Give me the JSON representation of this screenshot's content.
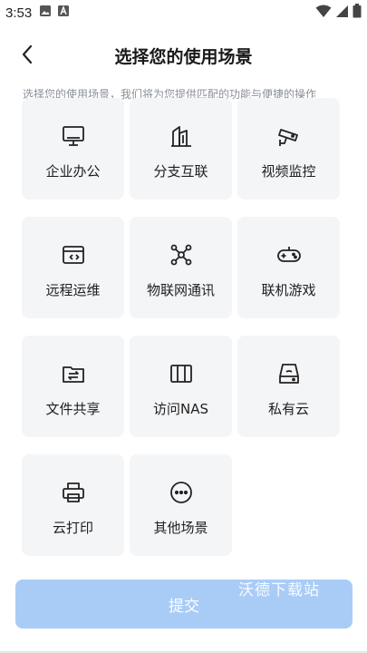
{
  "status_bar": {
    "time": "3:53",
    "icons": [
      "image-icon",
      "font-a-icon",
      "wifi-icon",
      "signal-icon",
      "battery-icon"
    ]
  },
  "header": {
    "title": "选择您的使用场景",
    "back_icon": "chevron-left-icon"
  },
  "subtitle": "选择您的使用场景，我们将为您提供匹配的功能与便捷的操作",
  "scenes": [
    {
      "label": "企业办公",
      "icon": "monitor-icon"
    },
    {
      "label": "分支互联",
      "icon": "buildings-icon"
    },
    {
      "label": "视频监控",
      "icon": "cctv-camera-icon"
    },
    {
      "label": "远程运维",
      "icon": "code-window-icon"
    },
    {
      "label": "物联网通讯",
      "icon": "iot-network-icon"
    },
    {
      "label": "联机游戏",
      "icon": "gamepad-icon"
    },
    {
      "label": "文件共享",
      "icon": "folder-share-icon"
    },
    {
      "label": "访问NAS",
      "icon": "nas-icon"
    },
    {
      "label": "私有云",
      "icon": "cloud-drive-icon"
    },
    {
      "label": "云打印",
      "icon": "printer-icon"
    },
    {
      "label": "其他场景",
      "icon": "more-dots-icon"
    }
  ],
  "submit": {
    "label": "提交"
  },
  "watermark": "沃德下载站",
  "colors": {
    "submit_bg": "#a9ccf7",
    "card_bg": "#f4f5f7",
    "subtitle": "#8a8f99"
  }
}
